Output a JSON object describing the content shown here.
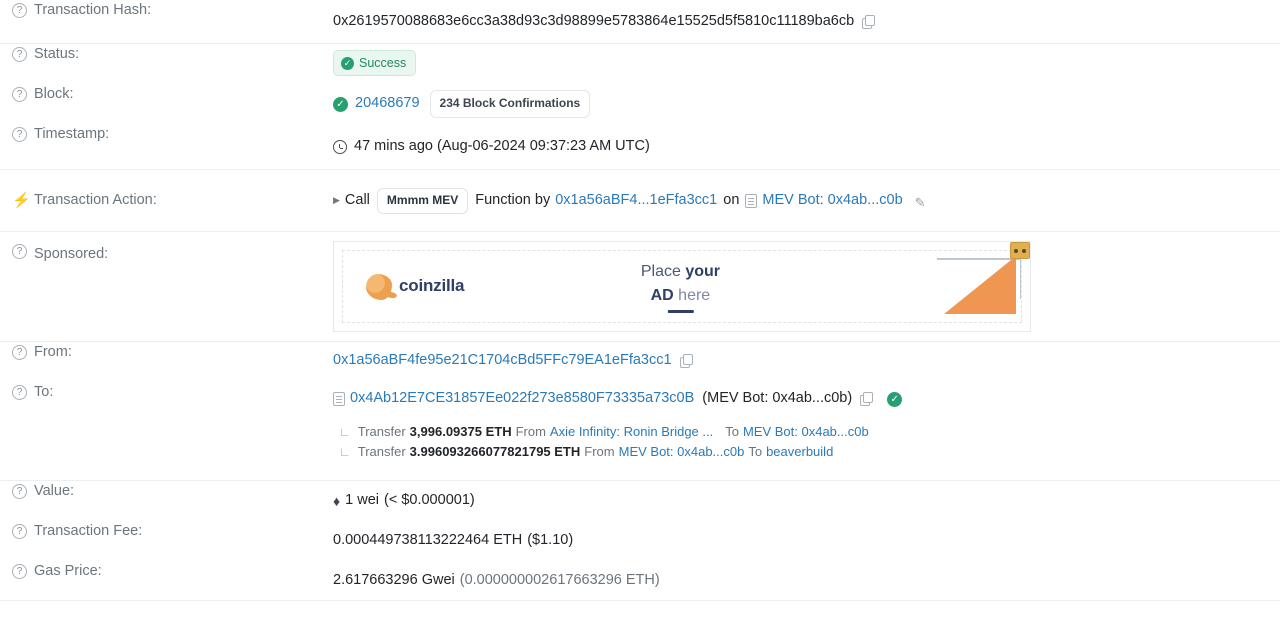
{
  "rows": {
    "tx_hash": {
      "label": "Transaction Hash:",
      "value": "0x2619570088683e6cc3a38d93c3d98899e5783864e15525d5f5810c11189ba6cb"
    },
    "status": {
      "label": "Status:",
      "value": "Success"
    },
    "block": {
      "label": "Block:",
      "number": "20468679",
      "confirmations": "234 Block Confirmations"
    },
    "timestamp": {
      "label": "Timestamp:",
      "value": "47 mins ago (Aug-06-2024 09:37:23 AM UTC)"
    },
    "transaction_action": {
      "label": "Transaction Action:",
      "call_word": "Call",
      "function_chip": "Mmmm MEV",
      "function_by": "Function by",
      "caller": "0x1a56aBF4...1eFfa3cc1",
      "on_word": "on",
      "contract": "MEV Bot: 0x4ab...c0b"
    },
    "sponsored": {
      "label": "Sponsored:",
      "ad": {
        "brand": "coinzilla",
        "line1_a": "Place ",
        "line1_b": "your",
        "line2_a": "AD",
        "line2_b": " here"
      }
    },
    "from": {
      "label": "From:",
      "value": "0x1a56aBF4fe95e21C1704cBd5FFc79EA1eFfa3cc1"
    },
    "to": {
      "label": "To:",
      "address": "0x4Ab12E7CE31857Ee022f273e8580F73335a73c0B",
      "tag": "(MEV Bot: 0x4ab...c0b)"
    },
    "internal_transfers": [
      {
        "prefix": "Transfer",
        "amount": "3,996.09375 ETH",
        "from_word": "From",
        "from": "Axie Infinity: Ronin Bridge ...",
        "to_word": "To",
        "to": "MEV Bot: 0x4ab...c0b"
      },
      {
        "prefix": "Transfer",
        "amount": "3.996093266077821795 ETH",
        "from_word": "From",
        "from": "MEV Bot: 0x4ab...c0b",
        "to_word": "To",
        "to": "beaverbuild"
      }
    ],
    "value": {
      "label": "Value:",
      "amount": "1 wei",
      "fiat": "(< $0.000001)"
    },
    "transaction_fee": {
      "label": "Transaction Fee:",
      "amount": "0.000449738113222464 ETH",
      "fiat": "($1.10)"
    },
    "gas_price": {
      "label": "Gas Price:",
      "amount": "2.617663296 Gwei",
      "eth": "(0.000000002617663296 ETH)"
    }
  },
  "icons": {
    "help": "?",
    "bolt": "⚡",
    "check": "✓",
    "caret": "▶",
    "pencil": "✎",
    "eth": "♦"
  },
  "colors": {
    "link": "#2a7ab9",
    "success": "#26a071",
    "muted": "#6c757d",
    "accent_orange": "#ef9752"
  }
}
